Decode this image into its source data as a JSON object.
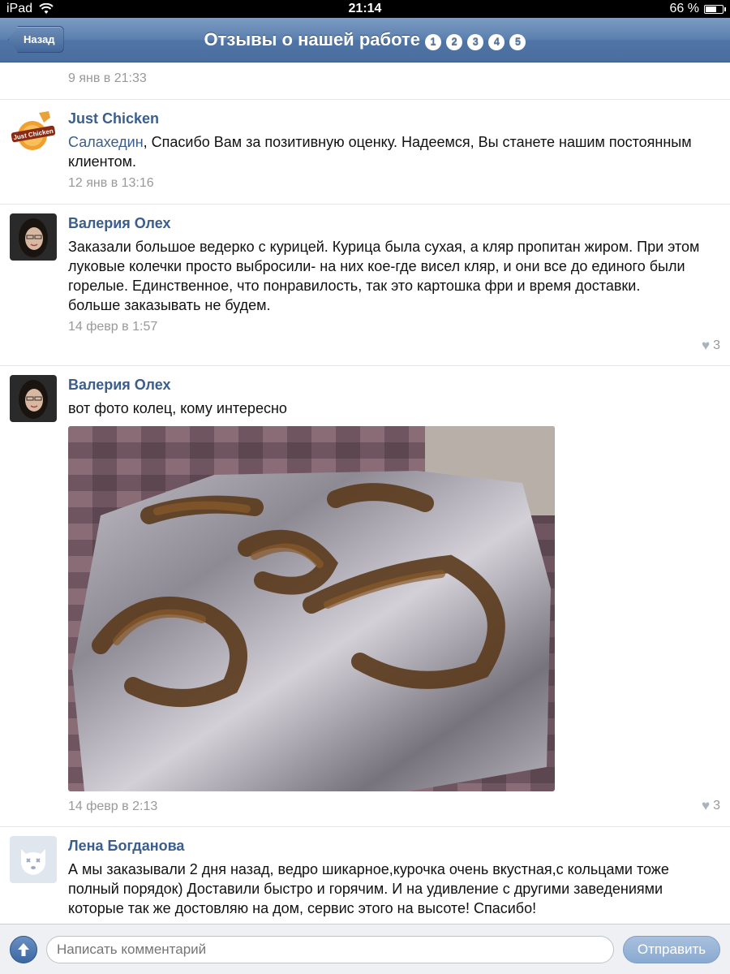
{
  "status_bar": {
    "carrier": "iPad",
    "time": "21:14",
    "battery": "66 %",
    "battery_level": 0.66
  },
  "nav": {
    "back_label": "Назад",
    "title": "Отзывы о нашей работе",
    "pages": [
      "1",
      "2",
      "3",
      "4",
      "5"
    ],
    "current_page": "1"
  },
  "comments": [
    {
      "author": "",
      "text": "",
      "date": "9 янв в 21:33",
      "likes": ""
    },
    {
      "author": "Just Chicken",
      "mention": "Салахедин",
      "text": ", Спасибо Вам за позитивную оценку. Надеемся, Вы станете нашим постоянным клиентом.",
      "date": "12 янв в 13:16",
      "likes": "",
      "avatar_text": "Just Chicken"
    },
    {
      "author": "Валерия Олех",
      "text": "Заказали большое ведерко с курицей. Курица была сухая, а кляр пропитан жиром. При этом луковые колечки просто выбросили- на них кое-где висел кляр, и они все до единого были горелые. Единственное, что понравилость, так это картошка фри и время доставки.\nбольше заказывать не будем.",
      "date": "14 февр в 1:57",
      "likes": "3"
    },
    {
      "author": "Валерия Олех",
      "text": "вот фото колец, кому интересно",
      "date": "14 февр в 2:13",
      "likes": "3"
    },
    {
      "author": "Лена Богданова",
      "text": "А мы заказывали 2 дня назад, ведро шикарное,курочка очень вкустная,с кольцами тоже полный порядок) Доставили быстро и горячим. И на удивление с другими заведениями которые так же достовляю на дом, сервис этого на высоте! Спасибо!",
      "date": "",
      "likes": ""
    }
  ],
  "composer": {
    "placeholder": "Написать комментарий",
    "send_label": "Отправить"
  },
  "colors": {
    "nav": "#5a7fae",
    "link": "#3b5e8c",
    "muted": "#999999",
    "send": "#8aa9d1"
  },
  "icons": {
    "wifi": "wifi-icon",
    "battery": "battery-icon",
    "heart": "heart-icon",
    "attach": "upload-arrow-icon"
  }
}
